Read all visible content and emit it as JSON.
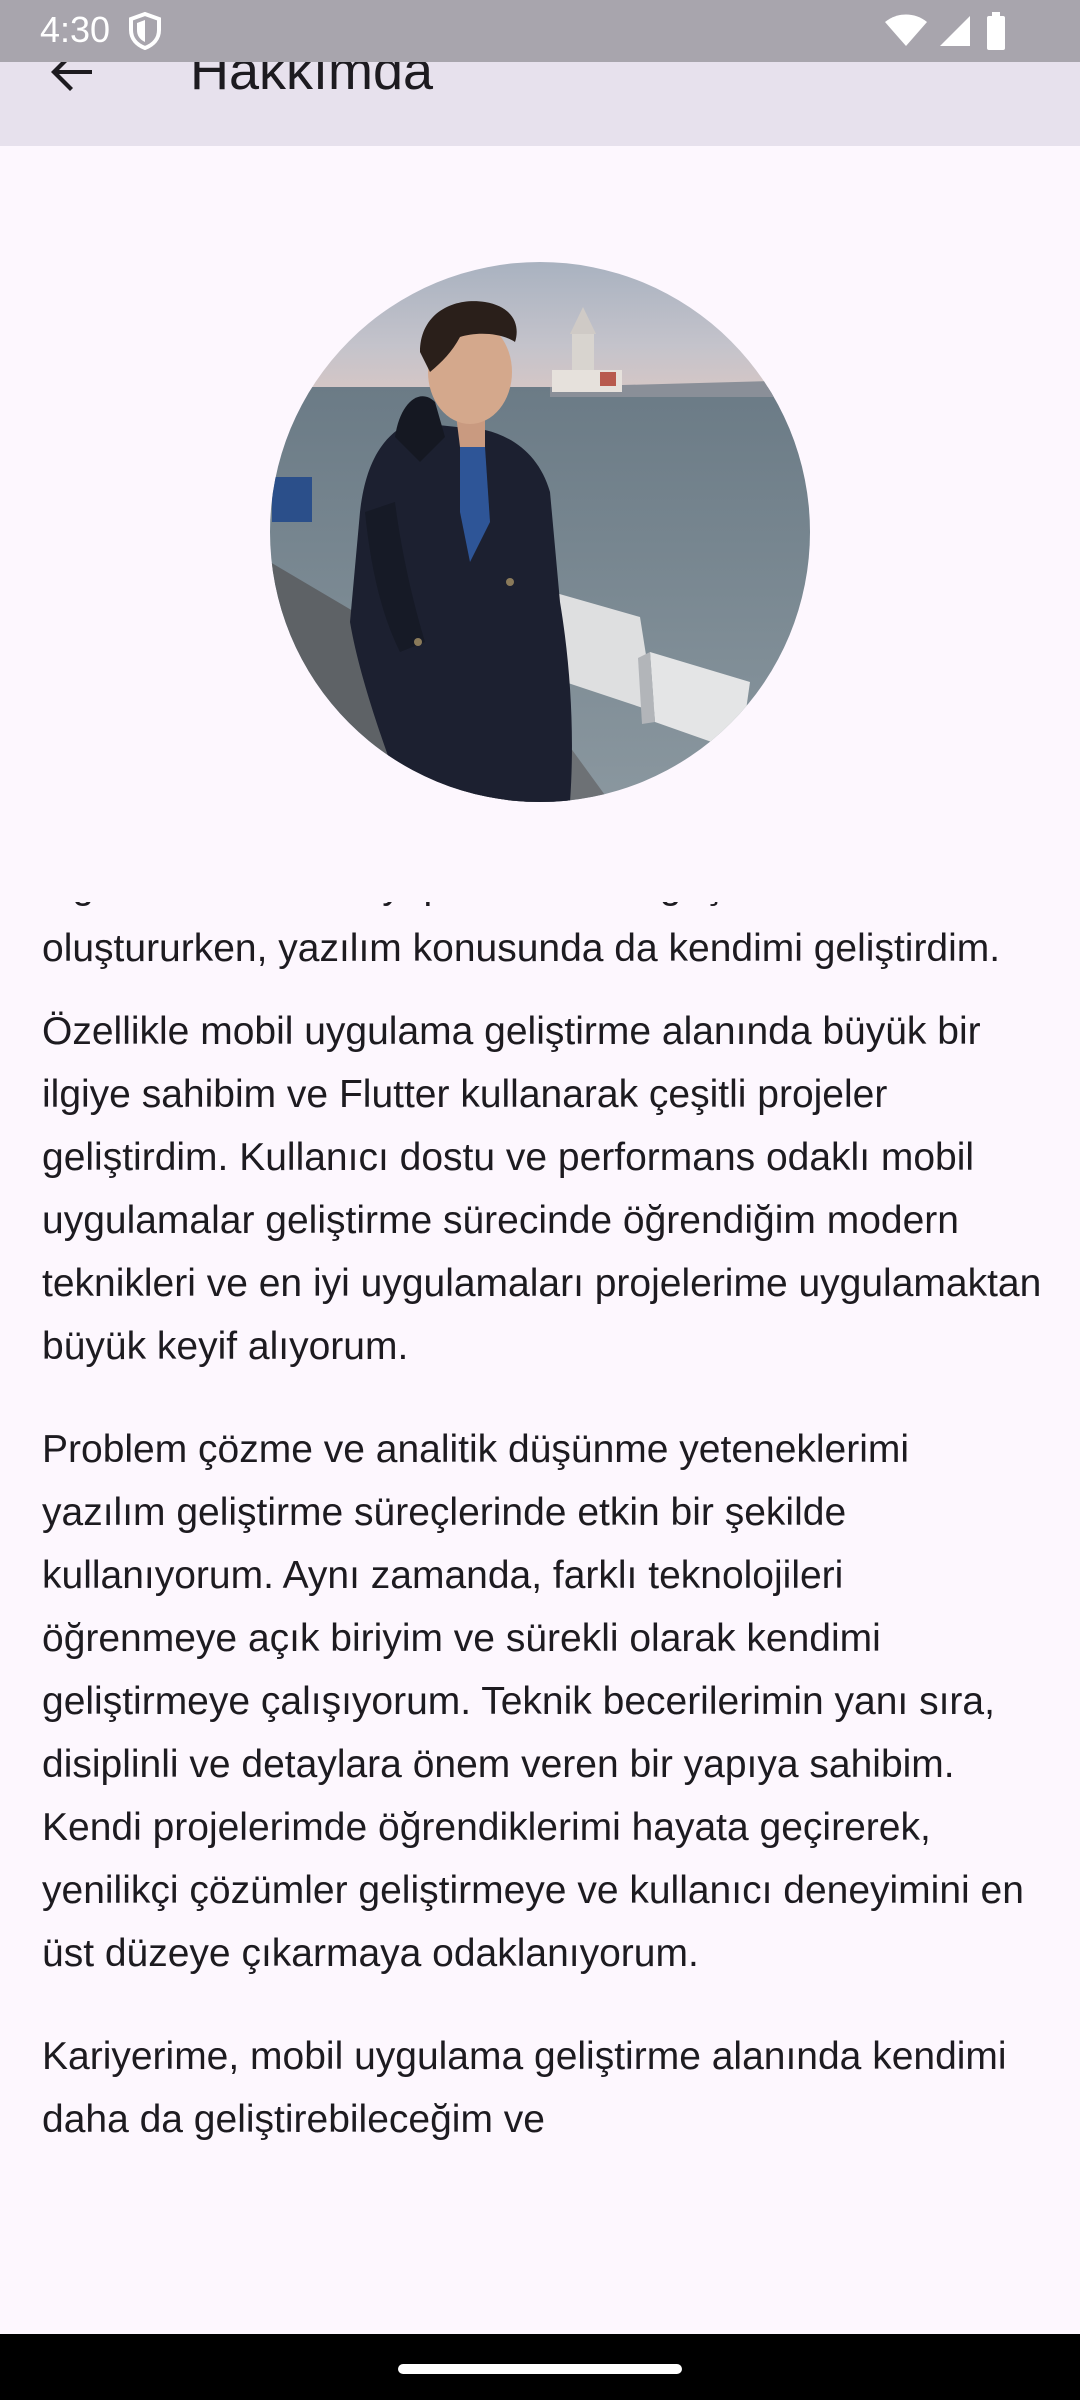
{
  "status_bar": {
    "time": "4:30",
    "icons": [
      "shield-icon",
      "wifi-icon",
      "signal-icon",
      "battery-icon"
    ]
  },
  "app_bar": {
    "title": "Hakkımda",
    "back_icon": "arrow-back-icon",
    "background": "#e7e1ed"
  },
  "profile": {
    "avatar": "profile-photo"
  },
  "about": {
    "paragraphs": [
      "algoritmalar ve veri yapıları üzerine güçlü bir temel oluştururken, yazılım konusunda da kendimi geliştirdim.",
      "Özellikle mobil uygulama geliştirme alanında büyük bir ilgiye sahibim ve Flutter kullanarak çeşitli projeler geliştirdim. Kullanıcı dostu ve performans odaklı mobil uygulamalar geliştirme sürecinde öğrendiğim modern teknikleri ve en iyi uygulamaları projelerime uygulamaktan büyük keyif alıyorum.",
      "Problem çözme ve analitik düşünme yeteneklerimi yazılım geliştirme süreçlerinde etkin bir şekilde kullanıyorum. Aynı zamanda, farklı teknolojileri öğrenmeye açık biriyim ve sürekli olarak kendimi geliştirmeye çalışıyorum. Teknik becerilerimin yanı sıra, disiplinli ve detaylara önem veren bir yapıya sahibim. Kendi projelerimde öğrendiklerimi hayata geçirerek, yenilikçi çözümler geliştirmeye ve kullanıcı deneyimini en üst düzeye çıkarmaya odaklanıyorum.",
      "Kariyerime, mobil uygulama geliştirme alanında kendimi daha da geliştirebileceğim ve"
    ]
  },
  "colors": {
    "background": "#fdf7fe",
    "text": "#1d1b20",
    "status_bar": "#a8a5ad"
  }
}
